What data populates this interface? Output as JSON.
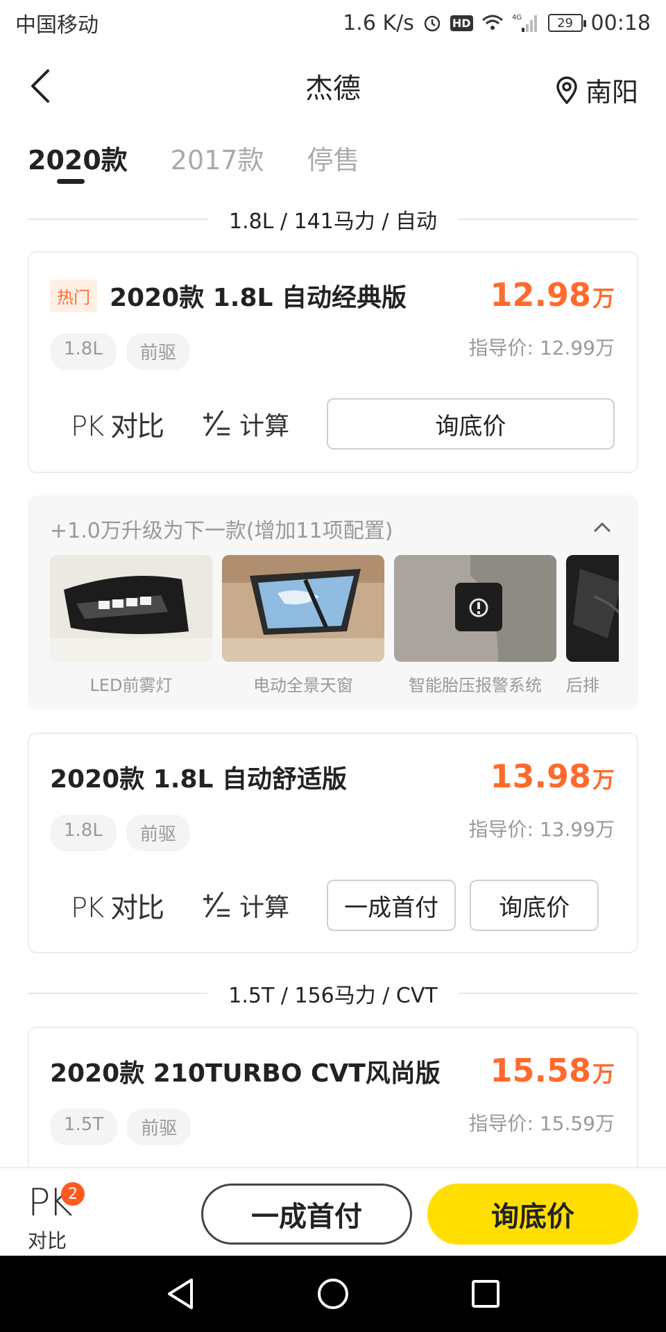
{
  "status_bar": {
    "carrier": "中国移动",
    "speed": "1.6 K/s",
    "hd": "HD",
    "network": "4G",
    "battery": "29",
    "time": "00:18"
  },
  "header": {
    "title": "杰德",
    "location": "南阳"
  },
  "tabs": [
    {
      "label": "2020款",
      "active": true
    },
    {
      "label": "2017款",
      "active": false
    },
    {
      "label": "停售",
      "active": false
    }
  ],
  "sections": [
    {
      "label": "1.8L / 141马力 / 自动"
    },
    {
      "label": "1.5T / 156马力 / CVT"
    }
  ],
  "cards": [
    {
      "badge": "热门",
      "title": "2020款 1.8L 自动经典版",
      "price": "12.98",
      "price_unit": "万",
      "guide_price": "指导价: 12.99万",
      "tags": [
        "1.8L",
        "前驱"
      ],
      "pk_label": "PK 对比",
      "calc_label": "计算",
      "inquiry_label": "询底价"
    },
    {
      "title": "2020款 1.8L 自动舒适版",
      "price": "13.98",
      "price_unit": "万",
      "guide_price": "指导价: 13.99万",
      "tags": [
        "1.8L",
        "前驱"
      ],
      "pk_label": "PK 对比",
      "calc_label": "计算",
      "down_payment_label": "一成首付",
      "inquiry_label": "询底价"
    },
    {
      "title": "2020款 210TURBO CVT风尚版",
      "price": "15.58",
      "price_unit": "万",
      "guide_price": "指导价: 15.59万",
      "tags": [
        "1.5T",
        "前驱"
      ]
    }
  ],
  "upgrade": {
    "text": "+1.0万升级为下一款(增加11项配置)",
    "features": [
      {
        "label": "LED前雾灯"
      },
      {
        "label": "电动全景天窗"
      },
      {
        "label": "智能胎压报警系统"
      },
      {
        "label": "后排"
      }
    ]
  },
  "bottom_bar": {
    "pk": "PK",
    "pk_count": "2",
    "pk_label": "对比",
    "down_payment_label": "一成首付",
    "inquiry_label": "询底价"
  },
  "colors": {
    "accent_orange": "#ff6a2c",
    "primary_yellow": "#ffde00",
    "badge_red": "#ff5a1f"
  },
  "icons": [
    "back-arrow-icon",
    "location-pin-icon",
    "calculator-icon",
    "chevron-up-icon",
    "nav-back-icon",
    "nav-home-icon",
    "nav-recents-icon"
  ]
}
